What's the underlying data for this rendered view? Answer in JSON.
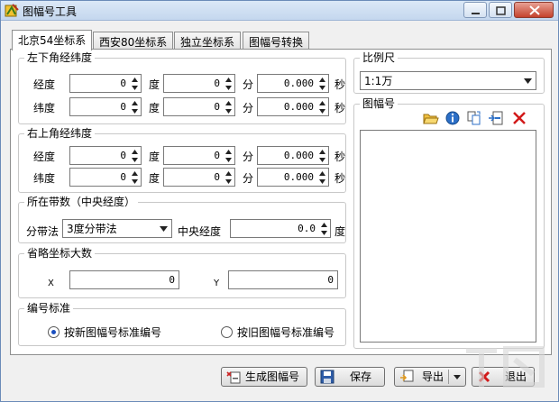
{
  "window": {
    "title": "图幅号工具",
    "app_icon": "map-icon"
  },
  "tabs": [
    {
      "label": "北京54坐标系",
      "active": true
    },
    {
      "label": "西安80坐标系",
      "active": false
    },
    {
      "label": "独立坐标系",
      "active": false
    },
    {
      "label": "图幅号转换",
      "active": false
    }
  ],
  "lower_left": {
    "title": "左下角经纬度",
    "lon_label": "经度",
    "lat_label": "纬度",
    "deg_unit": "度",
    "min_unit": "分",
    "sec_unit": "秒",
    "lon": {
      "deg": "0",
      "min": "0",
      "sec": "0.000"
    },
    "lat": {
      "deg": "0",
      "min": "0",
      "sec": "0.000"
    }
  },
  "upper_right": {
    "title": "右上角经纬度",
    "lon_label": "经度",
    "lat_label": "纬度",
    "deg_unit": "度",
    "min_unit": "分",
    "sec_unit": "秒",
    "lon": {
      "deg": "0",
      "min": "0",
      "sec": "0.000"
    },
    "lat": {
      "deg": "0",
      "min": "0",
      "sec": "0.000"
    }
  },
  "zone": {
    "title": "所在带数（中央经度）",
    "method_label": "分带法",
    "method_value": "3度分带法",
    "central_label": "中央经度",
    "central_value": "0.0",
    "central_unit": "度"
  },
  "false_coords": {
    "title": "省略坐标大数",
    "x_label": "X",
    "x_value": "0",
    "y_label": "Y",
    "y_value": "0"
  },
  "standard": {
    "title": "编号标准",
    "new_label": "按新图幅号标准编号",
    "old_label": "按旧图幅号标准编号",
    "selected": "new"
  },
  "scale": {
    "title": "比例尺",
    "value": "1:1万"
  },
  "sheet": {
    "title": "图幅号",
    "tools": [
      "open-folder-icon",
      "info-icon",
      "copy-icon",
      "export-icon",
      "delete-icon"
    ]
  },
  "buttons": {
    "generate": "生成图幅号",
    "save": "保存",
    "export": "导出",
    "exit": "退出"
  }
}
